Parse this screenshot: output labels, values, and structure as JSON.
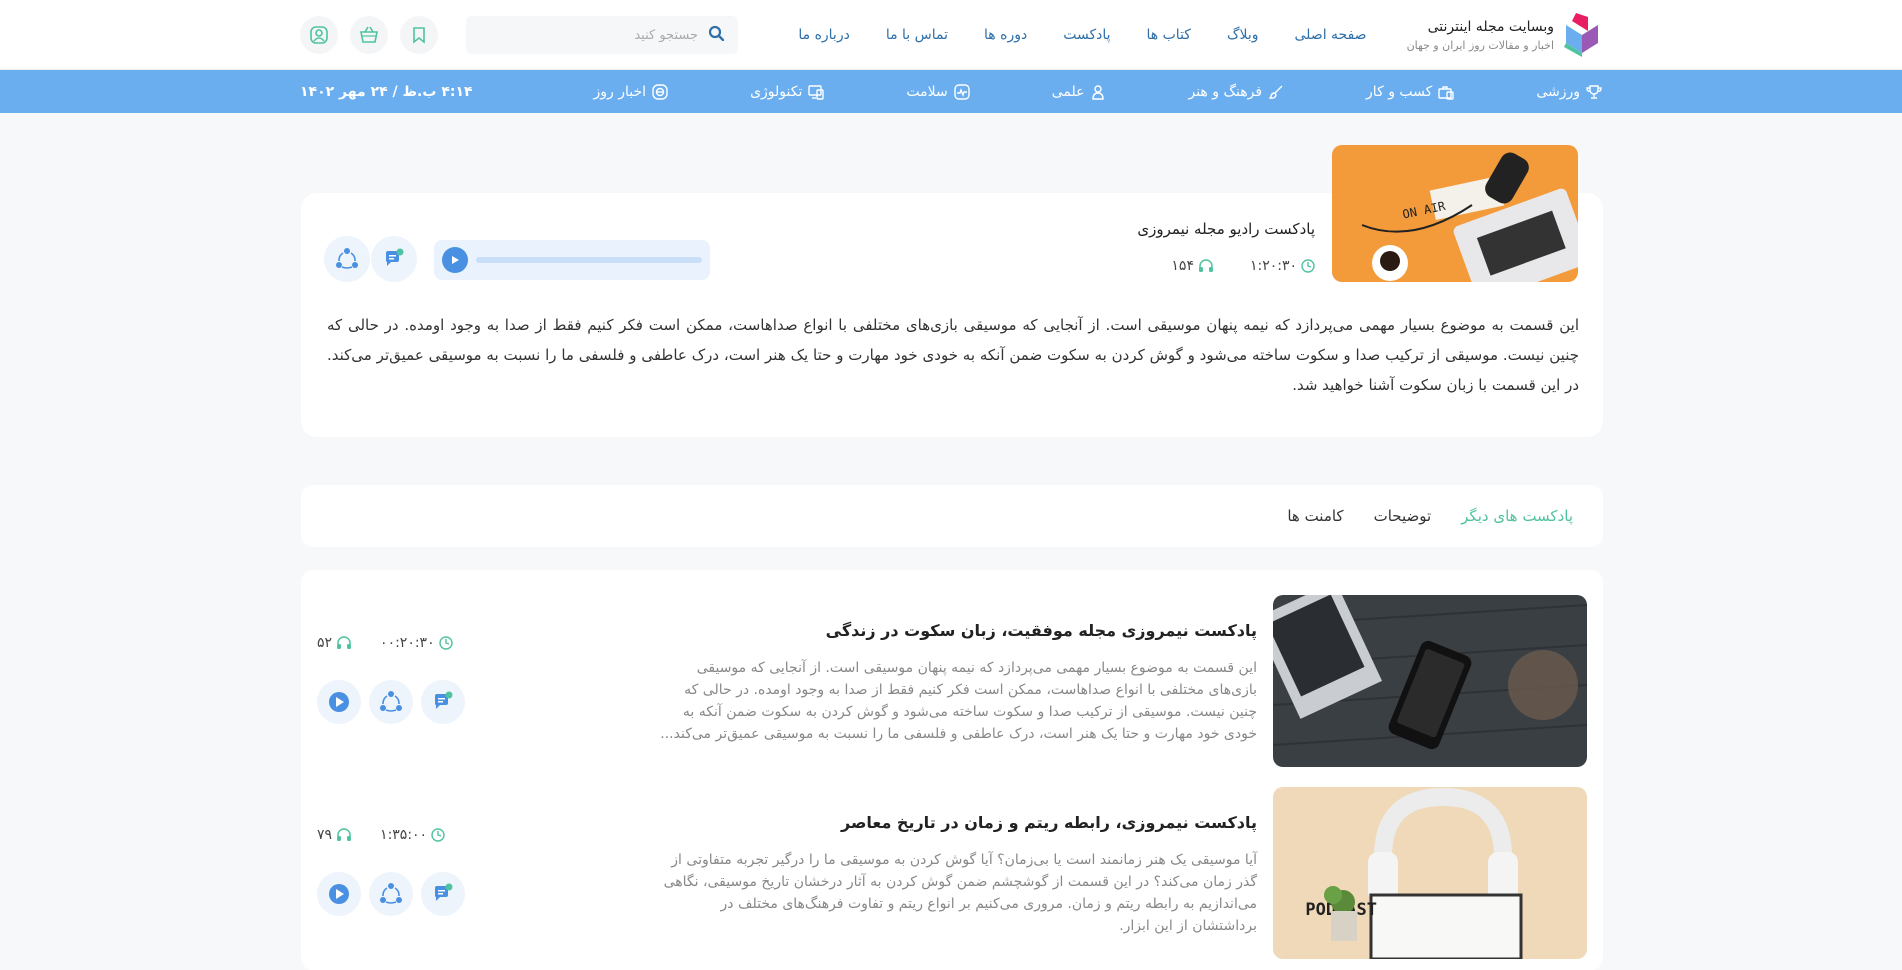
{
  "brand": {
    "name": "وبسایت مجله اینترنتی",
    "tagline": "اخبار و مقالات روز ایران و جهان",
    "colors": {
      "primary": "#4a90e2",
      "accent": "#4fc3a1",
      "catbar": "#6aaef0"
    }
  },
  "nav": [
    "صفحه اصلی",
    "وبلاگ",
    "کتاب ها",
    "پادکست",
    "دوره ها",
    "تماس با ما",
    "درباره ما"
  ],
  "search": {
    "placeholder": "جستجو کنید"
  },
  "header_icons": [
    "bookmark-icon",
    "basket-icon",
    "user-icon"
  ],
  "categories": [
    {
      "label": "ورزشی",
      "icon": "trophy-icon"
    },
    {
      "label": "کسب و کار",
      "icon": "briefcase-icon"
    },
    {
      "label": "فرهنگ و هنر",
      "icon": "brush-icon"
    },
    {
      "label": "علمی",
      "icon": "user-icon"
    },
    {
      "label": "سلامت",
      "icon": "pulse-icon"
    },
    {
      "label": "تکنولوژی",
      "icon": "device-icon"
    },
    {
      "label": "اخبار روز",
      "icon": "globe-icon"
    }
  ],
  "datetime": "۴:۱۴ ب.ظ / ۲۴ مهر ۱۴۰۲",
  "hero": {
    "title": "پادکست رادیو مجله نیمروزی",
    "duration": "۱:۲۰:۳۰",
    "listens": "۱۵۴",
    "progress": 0,
    "description": "این قسمت به موضوع بسیار مهمی می‌پردازد که نیمه پنهان موسیقی است. از آنجایی که موسیقی بازی‌های مختلفی با انواع صداهاست، ممکن است فکر کنیم فقط از صدا به وجود اومده. در حالی که چنین نیست. موسیقی از ترکیب صدا و سکوت ساخته می‌شود و گوش کردن به سکوت ضمن آنکه به خودی خود مهارت و حتا یک هنر است، درک عاطفی و فلسفی ما را نسبت به موسیقی عمیق‌تر می‌کند. در این قسمت با زبان سکوت آشنا خواهید شد."
  },
  "tabs": [
    {
      "label": "پادکست های دیگر",
      "active": true
    },
    {
      "label": "توضیحات",
      "active": false
    },
    {
      "label": "کامنت ها",
      "active": false
    }
  ],
  "podcasts": [
    {
      "title": "پادکست نیمروزی مجله موفقیت، زبان سکوت در زندگی",
      "duration": "۰۰:۲۰:۳۰",
      "listens": "۵۲",
      "description": "این قسمت به موضوع بسیار مهمی می‌پردازد که نیمه پنهان موسیقی است. از آنجایی که موسیقی بازی‌های مختلفی با انواع صداهاست، ممکن است فکر کنیم فقط از صدا به وجود اومده. در حالی که چنین نیست. موسیقی از ترکیب صدا و سکوت ساخته می‌شود و گوش کردن به سکوت ضمن آنکه به خودی خود مهارت و حتا یک هنر است، درک عاطفی و فلسفی ما را نسبت به موسیقی عمیق‌تر می‌کند..."
    },
    {
      "title": "پادکست نیمروزی، رابطه ریتم و زمان در تاریخ معاصر",
      "duration": "۱:۳۵:۰۰",
      "listens": "۷۹",
      "description": "آیا موسیقی یک هنر زمانمند است یا بی‌زمان؟ آیا گوش کردن به موسیقی ما را درگیر تجربه متفاوتی از گذر زمان می‌کند؟ در این قسمت از گوشچشم ضمن گوش کردن به آثار درخشان تاریخ موسیقی، نگاهی می‌اندازیم به رابطه ریتم و زمان. مروری می‌کنیم بر انواع ریتم و تفاوت فرهنگ‌های مختلف در برداشتشان از این ابزار."
    }
  ]
}
